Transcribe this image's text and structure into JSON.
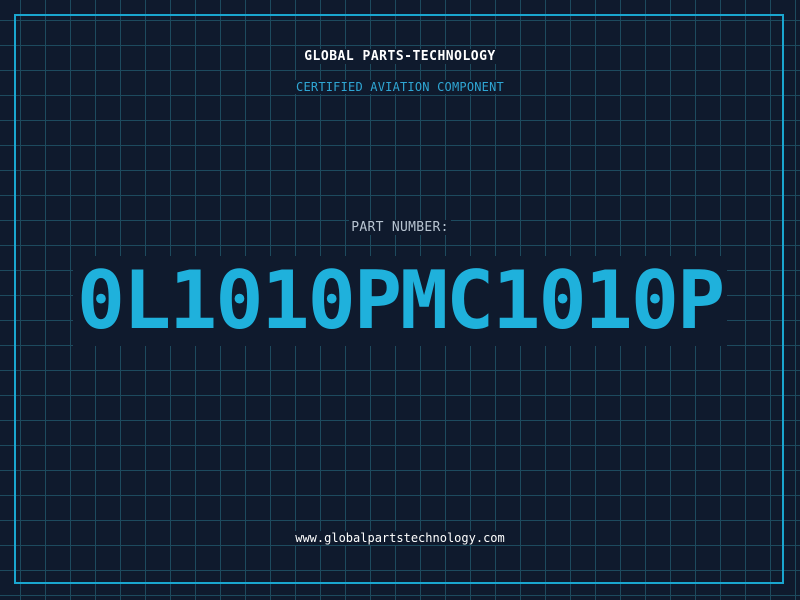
{
  "header": {
    "company": "GLOBAL PARTS-TECHNOLOGY",
    "tagline": "CERTIFIED AVIATION COMPONENT"
  },
  "part": {
    "label": "PART NUMBER:",
    "number": "0L1010PMC1010P"
  },
  "footer": {
    "website": "www.globalpartstechnology.com"
  },
  "colors": {
    "background": "#0f1a2d",
    "grid": "#1d4a5e",
    "accent": "#1fb1dc",
    "frame": "#1aa6cf"
  }
}
